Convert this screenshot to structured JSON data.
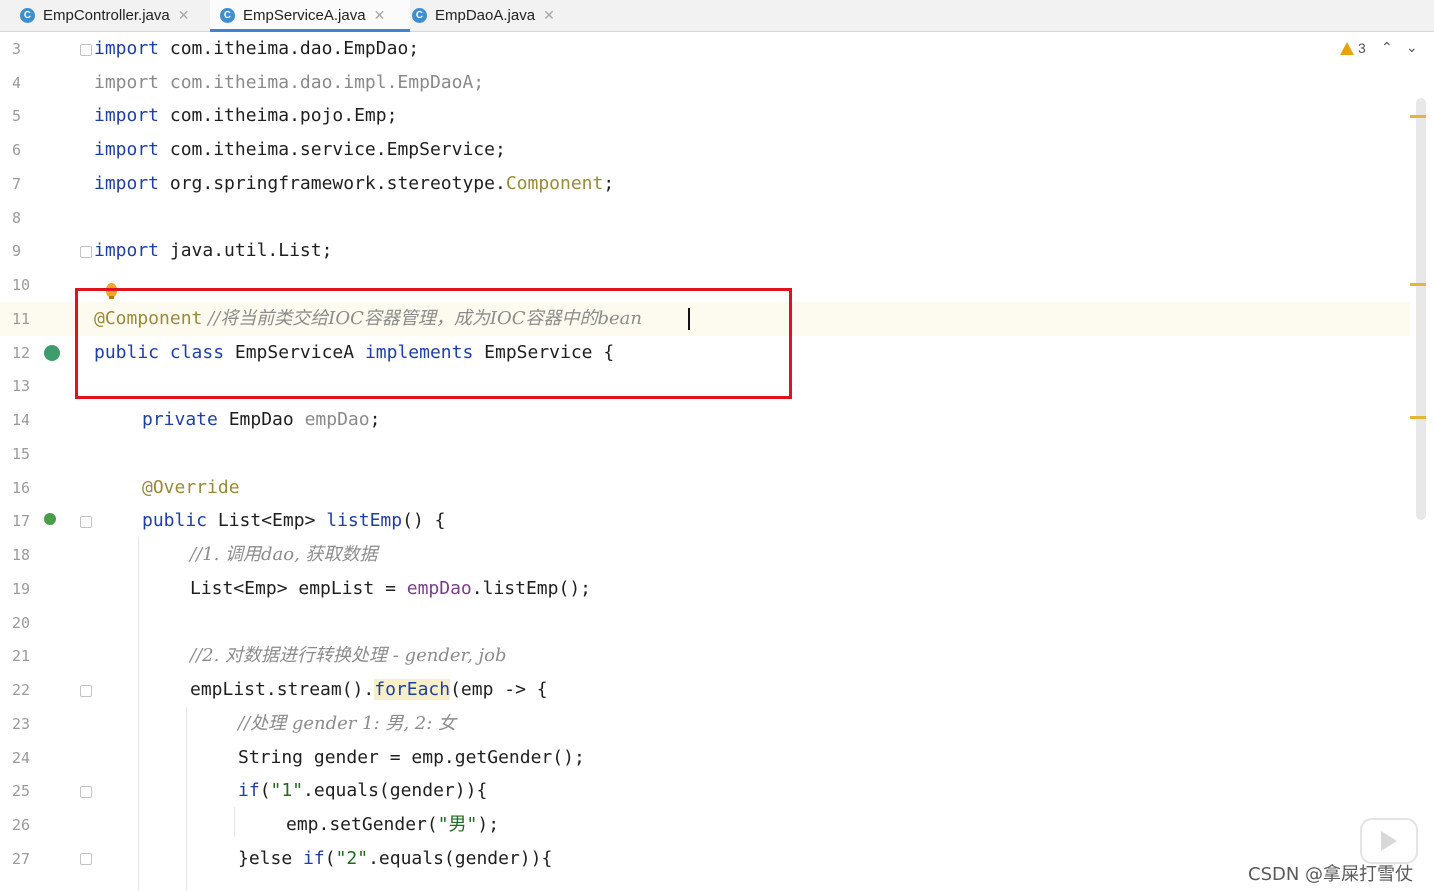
{
  "tabs": [
    {
      "label": "EmpController.java",
      "icon": "class-c-icon",
      "active": false
    },
    {
      "label": "EmpServiceA.java",
      "icon": "class-c-icon",
      "active": true
    },
    {
      "label": "EmpDaoA.java",
      "icon": "class-c-icon",
      "active": false
    }
  ],
  "inspection": {
    "warning_count": "3"
  },
  "lines": {
    "l3": {
      "num": "3",
      "t1": "import",
      "t2": " com.itheima.dao.EmpDao;"
    },
    "l4": {
      "num": "4",
      "t1": "import com.itheima.dao.impl.EmpDaoA;"
    },
    "l5": {
      "num": "5",
      "t1": "import",
      "t2": " com.itheima.pojo.Emp;"
    },
    "l6": {
      "num": "6",
      "t1": "import",
      "t2": " com.itheima.service.EmpService;"
    },
    "l7": {
      "num": "7",
      "t1": "import",
      "t2": " org.springframework.stereotype.",
      "t3": "Component",
      "t4": ";"
    },
    "l8": {
      "num": "8"
    },
    "l9": {
      "num": "9",
      "t1": "import",
      "t2": " java.util.List;"
    },
    "l10": {
      "num": "10"
    },
    "l11": {
      "num": "11",
      "t1": "@Component",
      "t2": " //将当前类交给IOC容器管理，成为IOC容器中的bean"
    },
    "l12": {
      "num": "12",
      "t1": "public class",
      "t2": " EmpServiceA ",
      "t3": "implements",
      "t4": " EmpService {"
    },
    "l13": {
      "num": "13"
    },
    "l14": {
      "num": "14",
      "t1": "private",
      "t2": " EmpDao ",
      "t3": "empDao",
      "t4": ";"
    },
    "l15": {
      "num": "15"
    },
    "l16": {
      "num": "16",
      "t1": "@Override"
    },
    "l17": {
      "num": "17",
      "t1": "public",
      "t2": " List<Emp> ",
      "t3": "listEmp",
      "t4": "() {"
    },
    "l18": {
      "num": "18",
      "t1": "//1. 调用dao, 获取数据"
    },
    "l19": {
      "num": "19",
      "t1": "List<Emp> empList = ",
      "t2": "empDao",
      "t3": ".listEmp();"
    },
    "l20": {
      "num": "20"
    },
    "l21": {
      "num": "21",
      "t1": "//2. 对数据进行转换处理 - gender, job"
    },
    "l22": {
      "num": "22",
      "t1": "empList.stream().",
      "t2": "forEach",
      "t3": "(emp -> {"
    },
    "l23": {
      "num": "23",
      "t1": "//处理 gender 1: 男, 2: 女"
    },
    "l24": {
      "num": "24",
      "t1": "String gender = emp.getGender();"
    },
    "l25": {
      "num": "25",
      "t1": "if",
      "t2": "(",
      "t3": "\"1\"",
      "t4": ".equals(gender)){"
    },
    "l26": {
      "num": "26",
      "t1": "emp.setGender(",
      "t2": "\"男\"",
      "t3": ");"
    },
    "l27": {
      "num": "27",
      "t1": "}else ",
      "t2": "if",
      "t3": "(",
      "t4": "\"2\"",
      "t5": ".equals(gender)){"
    }
  },
  "watermark": "CSDN @拿屎打雪仗"
}
